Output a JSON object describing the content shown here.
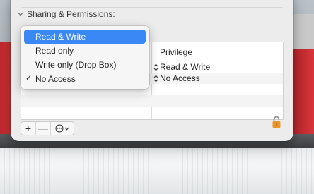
{
  "section": {
    "title": "Sharing & Permissions:"
  },
  "table": {
    "header_privilege": "Privilege",
    "rows": [
      {
        "privilege": "Read & Write"
      },
      {
        "privilege": "No Access"
      }
    ]
  },
  "menu": {
    "items": [
      {
        "label": "Read & Write",
        "highlighted": true,
        "checked": false
      },
      {
        "label": "Read only",
        "highlighted": false,
        "checked": false
      },
      {
        "label": "Write only (Drop Box)",
        "highlighted": false,
        "checked": false
      },
      {
        "label": "No Access",
        "highlighted": false,
        "checked": true
      }
    ],
    "check_mark": "✓"
  },
  "toolbar": {
    "add_label": "+",
    "remove_label": "—",
    "action_icon": "ellipsis-circle-icon"
  },
  "colors": {
    "highlight": "#3a88f5",
    "lock": "#e8962b"
  }
}
